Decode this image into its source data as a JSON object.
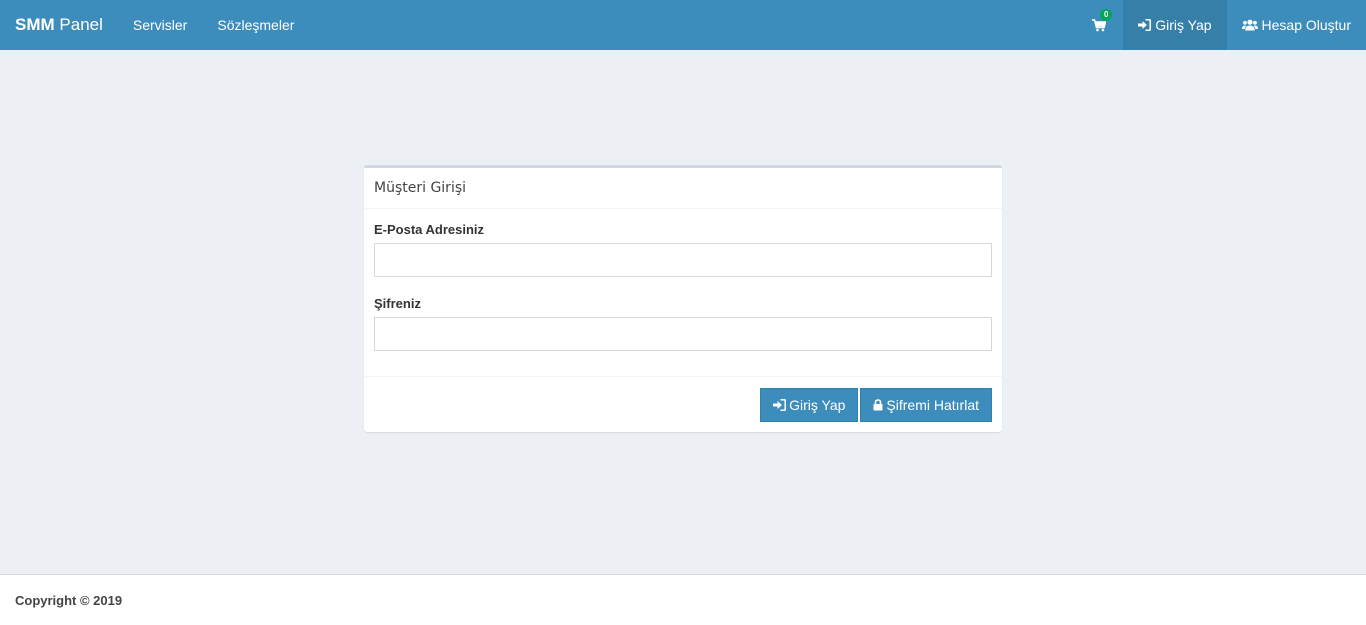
{
  "brand": {
    "bold": "SMM",
    "rest": "Panel"
  },
  "nav": {
    "services": "Servisler",
    "agreements": "Sözleşmeler",
    "cart_count": "0",
    "login": "Giriş Yap",
    "register": "Hesap Oluştur"
  },
  "login_panel": {
    "title": "Müşteri Girişi",
    "email_label": "E-Posta Adresiniz",
    "email_value": "",
    "password_label": "Şifreniz",
    "password_value": "",
    "login_button": "Giriş Yap",
    "forgot_button": "Şifremi Hatırlat"
  },
  "footer": {
    "copyright": "Copyright © 2019"
  },
  "icons": {
    "cart": "shopping-cart-icon",
    "login": "sign-in-icon",
    "register": "users-icon",
    "lock": "lock-icon"
  },
  "colors": {
    "navbar": "#3c8dbc",
    "navbar_active": "#367fa9",
    "badge": "#00a65a",
    "background": "#ecf0f5",
    "button": "#3c8dbc"
  }
}
